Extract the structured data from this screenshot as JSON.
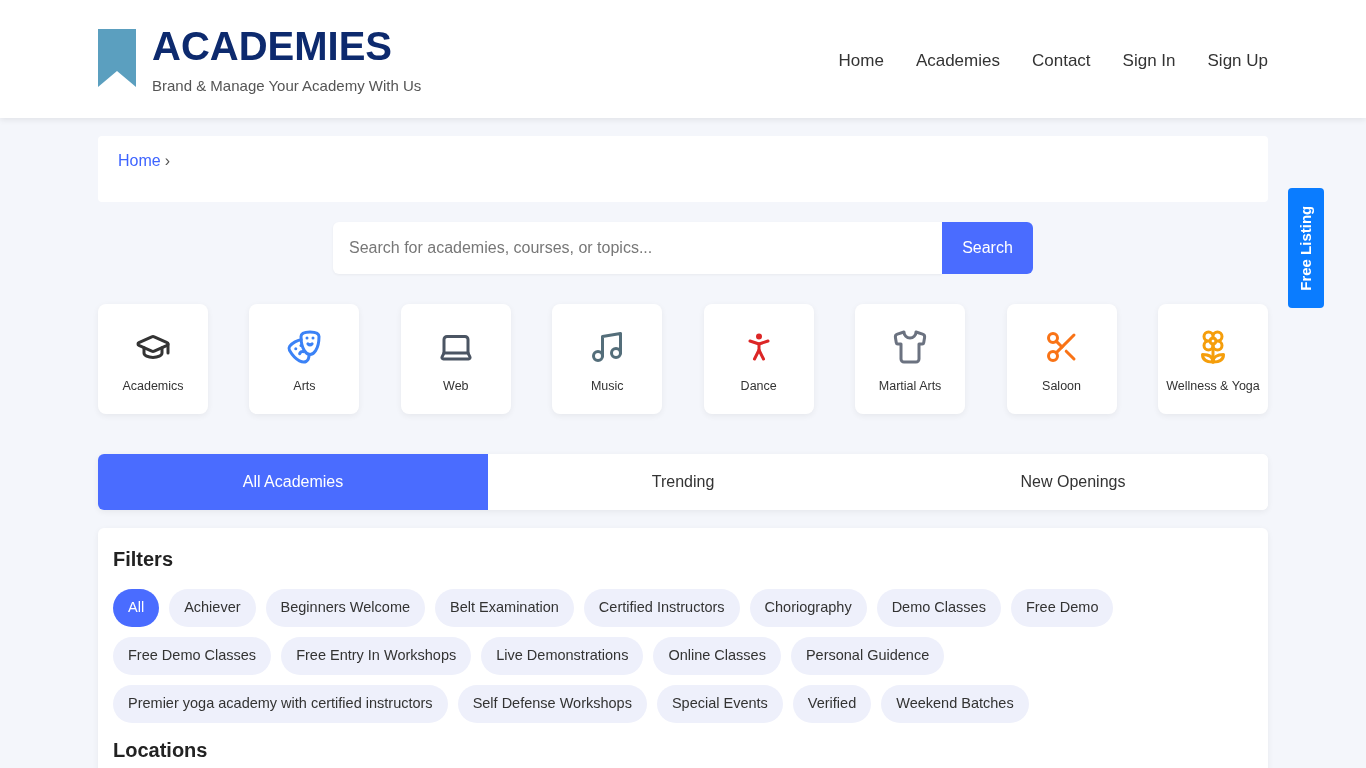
{
  "brand": {
    "title": "ACADEMIES",
    "tagline": "Brand & Manage Your Academy With Us"
  },
  "nav": [
    "Home",
    "Academies",
    "Contact",
    "Sign In",
    "Sign Up"
  ],
  "breadcrumb": {
    "link": "Home",
    "separator": "›"
  },
  "search": {
    "placeholder": "Search for academies, courses, or topics...",
    "button": "Search"
  },
  "categories": [
    "Academics",
    "Arts",
    "Web",
    "Music",
    "Dance",
    "Martial Arts",
    "Saloon",
    "Wellness & Yoga"
  ],
  "tabs": [
    {
      "label": "All Academies",
      "selected": true
    },
    {
      "label": "Trending",
      "selected": false
    },
    {
      "label": "New Openings",
      "selected": false
    }
  ],
  "filters": {
    "title": "Filters",
    "chips": [
      {
        "label": "All",
        "selected": true
      },
      {
        "label": "Achiever",
        "selected": false
      },
      {
        "label": "Beginners Welcome",
        "selected": false
      },
      {
        "label": "Belt Examination",
        "selected": false
      },
      {
        "label": "Certified Instructors",
        "selected": false
      },
      {
        "label": "Choriography",
        "selected": false
      },
      {
        "label": "Demo Classes",
        "selected": false
      },
      {
        "label": "Free Demo",
        "selected": false
      },
      {
        "label": "Free Demo Classes",
        "selected": false
      },
      {
        "label": "Free Entry In Workshops",
        "selected": false
      },
      {
        "label": "Live Demonstrations",
        "selected": false
      },
      {
        "label": "Online Classes",
        "selected": false
      },
      {
        "label": "Personal Guidence",
        "selected": false
      },
      {
        "label": "Premier yoga academy with certified instructors",
        "selected": false
      },
      {
        "label": "Self Defense Workshops",
        "selected": false
      },
      {
        "label": "Special Events",
        "selected": false
      },
      {
        "label": "Verified",
        "selected": false
      },
      {
        "label": "Weekend Batches",
        "selected": false
      }
    ]
  },
  "locations": {
    "title": "Locations"
  },
  "side_tab": "Free Listing"
}
